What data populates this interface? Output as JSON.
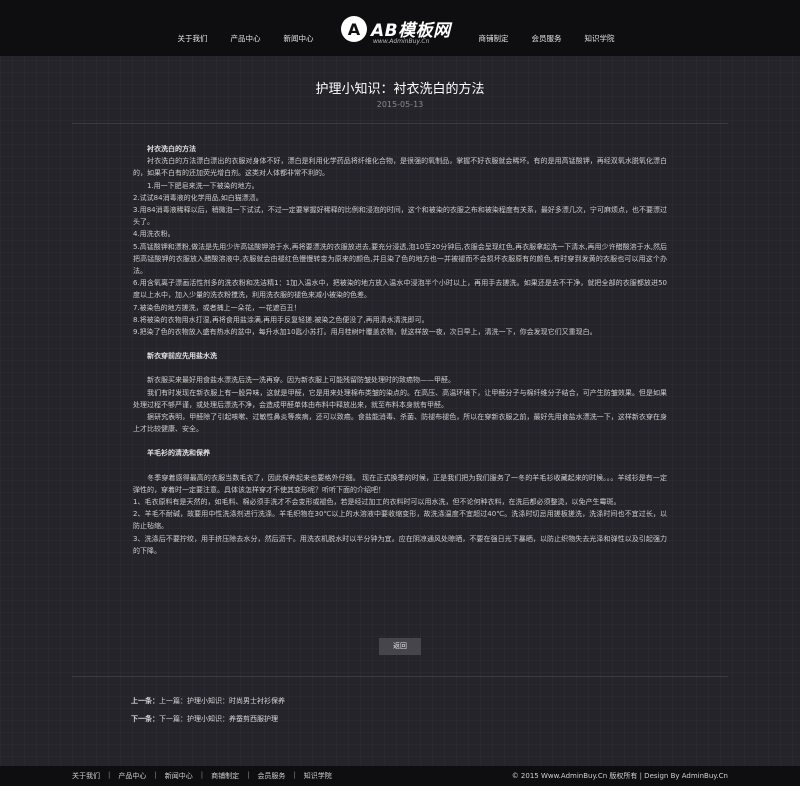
{
  "nav": {
    "left": [
      "关于我们",
      "产品中心",
      "新闻中心"
    ],
    "right": [
      "商铺制定",
      "会员服务",
      "知识学院"
    ]
  },
  "logo": {
    "mark": "A",
    "text": "AB模板网",
    "sub": "www.AdminBuy.Cn"
  },
  "article": {
    "title": "护理小知识：衬衣洗白的方法",
    "date": "2015-05-13",
    "paragraphs": [
      {
        "t": "衬衣洗白的方法",
        "sub": true
      },
      {
        "t": "　　衬衣洗白的方法漂白漂出的衣服对身体不好，漂白是利用化学药品将纤维化合物，是很强的氧制品，掌握不好衣服就会稀坏。有的是用高锰酸钾，再经双氧水脱氧化漂白的，如果不白有的还加荧光增白剂。这类对人体都非常不利的。"
      },
      {
        "t": "　　1.用一下肥皂来洗一下被染的地方。"
      },
      {
        "t": "2.试试84消毒液的化学用品,如白猫漂渍。"
      },
      {
        "t": "3.用84消毒液稀释以后，稍微泡一下试试，不过一定要掌握好稀释的比例和浸泡的时间，这个和被染的衣服之布和被染程度有关系，最好多漂几次，宁可麻烦点，也不要漂过头了。"
      },
      {
        "t": "4.用洗衣粉。"
      },
      {
        "t": "5.高锰酸钾和漂粉,做法是先用少许高锰酸钾溶于水,再将要漂洗的衣服放进去,要充分浸透,泡10至20分钟后,衣服会呈现红色,再衣服拿起洗一下清水,再用少许醋酸溶于水,然后把高锰酸钾的衣服放入醋酸溶液中,衣服就会由褪红色慢慢转变为原来的颜色,并且染了色的地方也一并被褪而不会损坏衣服原有的颜色,有时穿到发黄的衣服也可以用这个办法。"
      },
      {
        "t": "6.用含氧离子漂画活性剂多的洗衣粉和冼洁精1：1加入温水中，把被染的地方放入温水中浸泡半个小时以上，再用手去搓洗。如果还是去不干净，就把全部的衣服都放进50度以上水中，加入少量的洗衣粉搅洗，利用洗衣服的褪色来减小被染的色差。"
      },
      {
        "t": "7.被染色的地方搓洗，或者捕上一朵花，一花遮百丑！"
      },
      {
        "t": "8.将被染的衣物用水打湿,再将食用盐涂满,再用手反复轻搓.被染之色便没了,再用清水清洗即可。"
      },
      {
        "t": "9.把染了色的衣物放入盛有热水的盆中，每升水加10匙小苏打。用月桂树叶覆盖衣物，就这样放一夜，次日早上，清洗一下，你会发现它们又重现白。"
      },
      {
        "t": "",
        "gap": true
      },
      {
        "t": "新衣穿前应先用盐水洗",
        "sub": true
      },
      {
        "t": "",
        "gap": true
      },
      {
        "t": "　　新衣服买来最好用食盐水漂洗后洗一洗再穿。因为新衣服上可能残留防皱处理时的致癌物——甲醛。"
      },
      {
        "t": "　　我们有时发现在新衣服上有一股异味，这就是甲醛，它是用来处理棉布类皱的染点的。在高压、高温环境下，让甲醛分子与棉纤维分子结合，可产生防皱效果。但是如果处理过程不够严谨，或处理后漂洗不净，会造成甲醛单体由布料中释放出来，就至布料本身就有甲醛。"
      },
      {
        "t": "　　据研究表明，甲醛除了引起咳嗽、过敏性鼻炎等疾病，还可以致癌。食盐能消毒、杀菌、防褪布褪色，所以在穿新衣服之前，最好先用食盐水漂洗一下，这样新衣穿在身上才比较健康、安全。"
      },
      {
        "t": "",
        "gap": true
      },
      {
        "t": "羊毛衫的清洗和保养",
        "sub": true
      },
      {
        "t": "",
        "gap": true
      },
      {
        "t": "　　冬季穿着感得最高的衣服当数毛衣了，因此保养起来也要格外仔细。 现在正式换季的时候，正是我们把为我们服务了一冬的羊毛衫收藏起来的时候。。。羊绒衫是有一定弹性的，穿着时一定要注意。具体该怎样穿才不使其变形呢？听听下面的介绍吧！"
      },
      {
        "t": "1、毛衣原料有是天然的，如毛料、棉必须手洗才不会变形或褪色，若是经过加工的衣料时可以用水洗，但不论何种衣料，在洗后都必须整烫，以免产生霉斑。"
      },
      {
        "t": "2、羊毛不耐碱，故要用中性洗涤剂进行洗涤。羊毛织物在30℃以上的水溶液中要收缩变形，故洗涤温度不宜超过40℃。洗涤时切忌用搓板搓洗，洗涤时间也不宜过长，以防止毡缩。"
      },
      {
        "t": "3、洗涤后不要拧绞，用手挤压除去水分，然后沥干。用洗衣机脱水时以半分钟为宜。应在阴凉通风处晾晒，不要在强日光下暴晒，以防止织物失去光泽和弹性以及引起强力的下降。"
      }
    ]
  },
  "back_label": "返回",
  "prev": {
    "label": "上一条：",
    "link": "上一篇：护理小知识：时尚男士衬衫保养"
  },
  "next": {
    "label": "下一条：",
    "link": "下一篇：护理小知识：养蚕剪西服护理"
  },
  "footer": {
    "links": [
      "关于我们",
      "产品中心",
      "新闻中心",
      "商铺制定",
      "会员服务",
      "知识学院"
    ],
    "copyright": "© 2015 Www.AdminBuy.Cn 版权所有 | Design By AdminBuy.Cn"
  }
}
